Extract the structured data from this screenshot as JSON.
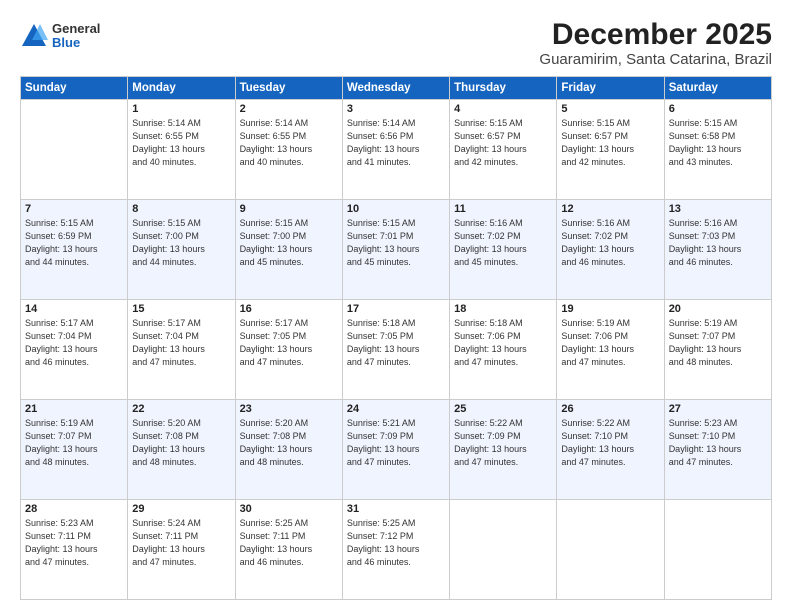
{
  "logo": {
    "general": "General",
    "blue": "Blue"
  },
  "title": "December 2025",
  "subtitle": "Guaramirim, Santa Catarina, Brazil",
  "weekdays": [
    "Sunday",
    "Monday",
    "Tuesday",
    "Wednesday",
    "Thursday",
    "Friday",
    "Saturday"
  ],
  "weeks": [
    [
      {
        "num": "",
        "info": ""
      },
      {
        "num": "1",
        "info": "Sunrise: 5:14 AM\nSunset: 6:55 PM\nDaylight: 13 hours\nand 40 minutes."
      },
      {
        "num": "2",
        "info": "Sunrise: 5:14 AM\nSunset: 6:55 PM\nDaylight: 13 hours\nand 40 minutes."
      },
      {
        "num": "3",
        "info": "Sunrise: 5:14 AM\nSunset: 6:56 PM\nDaylight: 13 hours\nand 41 minutes."
      },
      {
        "num": "4",
        "info": "Sunrise: 5:15 AM\nSunset: 6:57 PM\nDaylight: 13 hours\nand 42 minutes."
      },
      {
        "num": "5",
        "info": "Sunrise: 5:15 AM\nSunset: 6:57 PM\nDaylight: 13 hours\nand 42 minutes."
      },
      {
        "num": "6",
        "info": "Sunrise: 5:15 AM\nSunset: 6:58 PM\nDaylight: 13 hours\nand 43 minutes."
      }
    ],
    [
      {
        "num": "7",
        "info": "Sunrise: 5:15 AM\nSunset: 6:59 PM\nDaylight: 13 hours\nand 44 minutes."
      },
      {
        "num": "8",
        "info": "Sunrise: 5:15 AM\nSunset: 7:00 PM\nDaylight: 13 hours\nand 44 minutes."
      },
      {
        "num": "9",
        "info": "Sunrise: 5:15 AM\nSunset: 7:00 PM\nDaylight: 13 hours\nand 45 minutes."
      },
      {
        "num": "10",
        "info": "Sunrise: 5:15 AM\nSunset: 7:01 PM\nDaylight: 13 hours\nand 45 minutes."
      },
      {
        "num": "11",
        "info": "Sunrise: 5:16 AM\nSunset: 7:02 PM\nDaylight: 13 hours\nand 45 minutes."
      },
      {
        "num": "12",
        "info": "Sunrise: 5:16 AM\nSunset: 7:02 PM\nDaylight: 13 hours\nand 46 minutes."
      },
      {
        "num": "13",
        "info": "Sunrise: 5:16 AM\nSunset: 7:03 PM\nDaylight: 13 hours\nand 46 minutes."
      }
    ],
    [
      {
        "num": "14",
        "info": "Sunrise: 5:17 AM\nSunset: 7:04 PM\nDaylight: 13 hours\nand 46 minutes."
      },
      {
        "num": "15",
        "info": "Sunrise: 5:17 AM\nSunset: 7:04 PM\nDaylight: 13 hours\nand 47 minutes."
      },
      {
        "num": "16",
        "info": "Sunrise: 5:17 AM\nSunset: 7:05 PM\nDaylight: 13 hours\nand 47 minutes."
      },
      {
        "num": "17",
        "info": "Sunrise: 5:18 AM\nSunset: 7:05 PM\nDaylight: 13 hours\nand 47 minutes."
      },
      {
        "num": "18",
        "info": "Sunrise: 5:18 AM\nSunset: 7:06 PM\nDaylight: 13 hours\nand 47 minutes."
      },
      {
        "num": "19",
        "info": "Sunrise: 5:19 AM\nSunset: 7:06 PM\nDaylight: 13 hours\nand 47 minutes."
      },
      {
        "num": "20",
        "info": "Sunrise: 5:19 AM\nSunset: 7:07 PM\nDaylight: 13 hours\nand 48 minutes."
      }
    ],
    [
      {
        "num": "21",
        "info": "Sunrise: 5:19 AM\nSunset: 7:07 PM\nDaylight: 13 hours\nand 48 minutes."
      },
      {
        "num": "22",
        "info": "Sunrise: 5:20 AM\nSunset: 7:08 PM\nDaylight: 13 hours\nand 48 minutes."
      },
      {
        "num": "23",
        "info": "Sunrise: 5:20 AM\nSunset: 7:08 PM\nDaylight: 13 hours\nand 48 minutes."
      },
      {
        "num": "24",
        "info": "Sunrise: 5:21 AM\nSunset: 7:09 PM\nDaylight: 13 hours\nand 47 minutes."
      },
      {
        "num": "25",
        "info": "Sunrise: 5:22 AM\nSunset: 7:09 PM\nDaylight: 13 hours\nand 47 minutes."
      },
      {
        "num": "26",
        "info": "Sunrise: 5:22 AM\nSunset: 7:10 PM\nDaylight: 13 hours\nand 47 minutes."
      },
      {
        "num": "27",
        "info": "Sunrise: 5:23 AM\nSunset: 7:10 PM\nDaylight: 13 hours\nand 47 minutes."
      }
    ],
    [
      {
        "num": "28",
        "info": "Sunrise: 5:23 AM\nSunset: 7:11 PM\nDaylight: 13 hours\nand 47 minutes."
      },
      {
        "num": "29",
        "info": "Sunrise: 5:24 AM\nSunset: 7:11 PM\nDaylight: 13 hours\nand 47 minutes."
      },
      {
        "num": "30",
        "info": "Sunrise: 5:25 AM\nSunset: 7:11 PM\nDaylight: 13 hours\nand 46 minutes."
      },
      {
        "num": "31",
        "info": "Sunrise: 5:25 AM\nSunset: 7:12 PM\nDaylight: 13 hours\nand 46 minutes."
      },
      {
        "num": "",
        "info": ""
      },
      {
        "num": "",
        "info": ""
      },
      {
        "num": "",
        "info": ""
      }
    ]
  ]
}
